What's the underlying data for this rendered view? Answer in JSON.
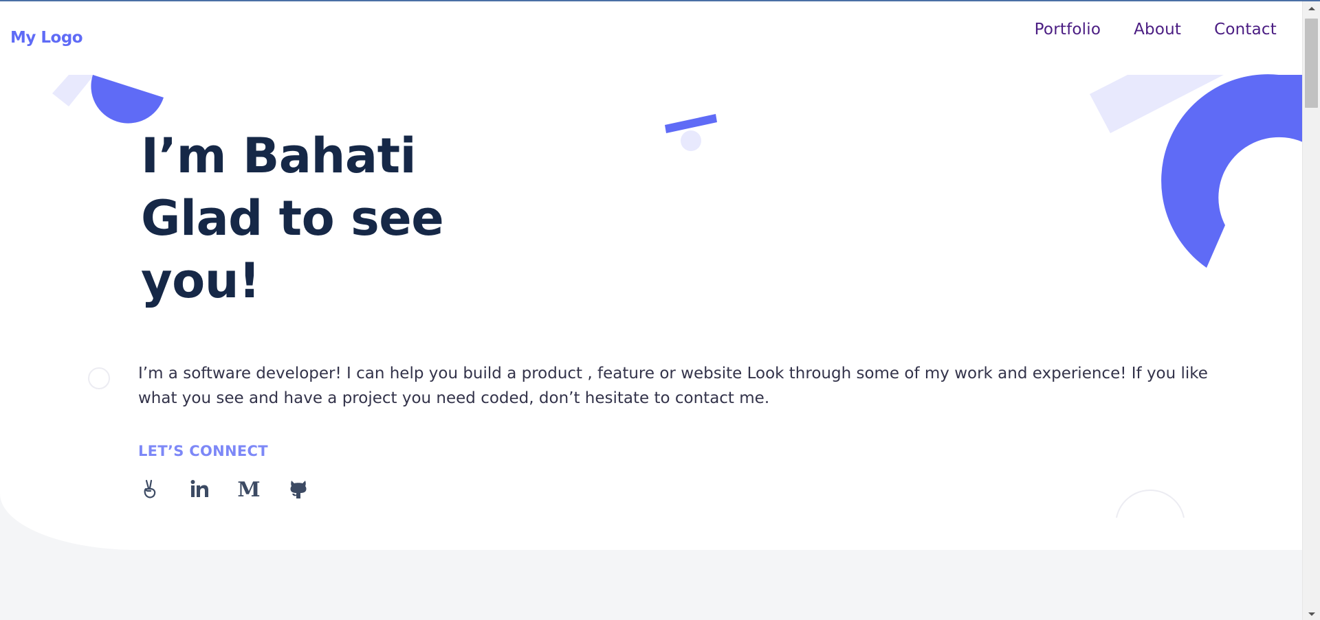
{
  "header": {
    "logo": "My Logo",
    "nav": [
      "Portfolio",
      "About",
      "Contact"
    ]
  },
  "hero": {
    "headline_lines": [
      "I’m Bahati",
      "Glad to see",
      "you!"
    ],
    "intro": "I’m a software developer! I can help you build a product , feature or website Look through some of my work and experience! If you like what you see and have a project you need coded, don’t hesitate to contact me.",
    "connect_title": "LET’S CONNECT",
    "socials": [
      {
        "name": "AngelList",
        "icon": "angellist-icon"
      },
      {
        "name": "LinkedIn",
        "icon": "linkedin-icon",
        "glyph": "in"
      },
      {
        "name": "Medium",
        "icon": "medium-icon",
        "glyph": "M"
      },
      {
        "name": "GitHub",
        "icon": "github-icon"
      }
    ]
  },
  "colors": {
    "accent": "#5f6bf6",
    "accent_light": "#e8e9fd",
    "heading": "#162847",
    "nav": "#4a1c82",
    "connect": "#7d88f7",
    "background": "#f4f5f7"
  }
}
